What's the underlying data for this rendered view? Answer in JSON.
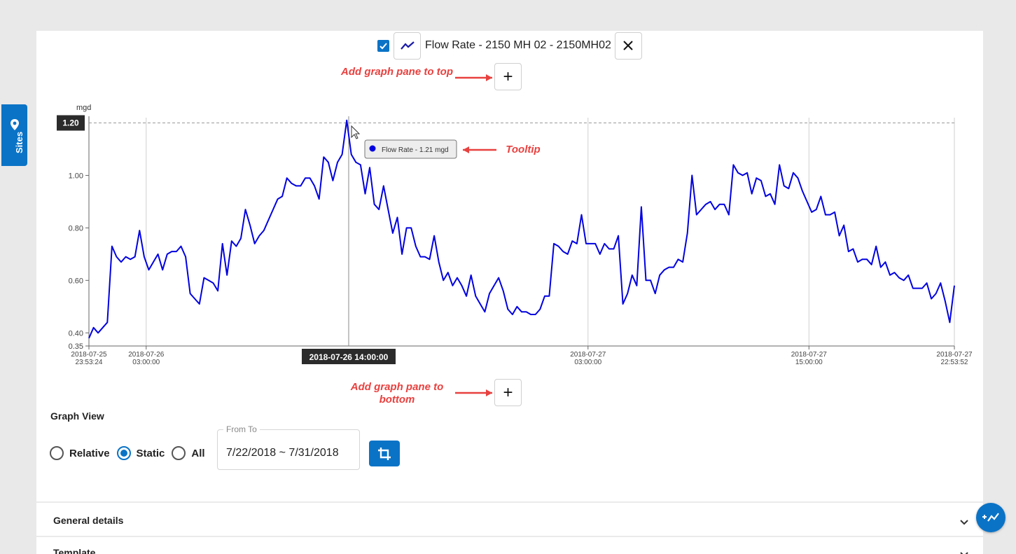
{
  "sidebar_tab": {
    "label": "Sites"
  },
  "legend": {
    "checked": true,
    "series_label": "Flow Rate - 2150 MH 02 - 2150MH02",
    "line_color": "#0000e0"
  },
  "annotations": {
    "add_top": "Add graph pane to top",
    "tooltip": "Tooltip",
    "add_bottom": "Add graph pane to bottom",
    "color": "#e8413f"
  },
  "add_button_label": "+",
  "chart_data": {
    "type": "line",
    "ylabel": "mgd",
    "ylim": [
      0.35,
      1.22
    ],
    "y_ticks": [
      "0.35",
      "0.40",
      "0.60",
      "0.80",
      "1.00"
    ],
    "y_tick_values": [
      0.35,
      0.4,
      0.6,
      0.8,
      1.0
    ],
    "reference_line": {
      "value": 1.2,
      "label": "1.20"
    },
    "x_ticks": [
      {
        "date": "2018-07-25",
        "time": "23:53:24",
        "hours": 0
      },
      {
        "date": "2018-07-26",
        "time": "03:00:00",
        "hours": 3.11
      },
      {
        "date": "2018-07-27",
        "time": "03:00:00",
        "hours": 27.11
      },
      {
        "date": "2018-07-27",
        "time": "15:00:00",
        "hours": 39.11
      },
      {
        "date": "2018-07-27",
        "time": "22:53:52",
        "hours": 47.01
      }
    ],
    "x_range_hours": [
      0,
      47.01
    ],
    "crosshair": {
      "label": "2018-07-26 14:00:00",
      "hours": 14.11
    },
    "tooltip": {
      "text": "Flow Rate - 1.21 mgd",
      "value": 1.21
    },
    "grid": "vertical",
    "series": [
      {
        "name": "Flow Rate",
        "color": "#0000e0",
        "values": [
          0.38,
          0.42,
          0.4,
          0.42,
          0.44,
          0.73,
          0.69,
          0.67,
          0.69,
          0.68,
          0.69,
          0.79,
          0.69,
          0.64,
          0.67,
          0.7,
          0.64,
          0.7,
          0.71,
          0.71,
          0.73,
          0.69,
          0.55,
          0.53,
          0.51,
          0.61,
          0.6,
          0.59,
          0.56,
          0.74,
          0.62,
          0.75,
          0.73,
          0.76,
          0.87,
          0.81,
          0.74,
          0.77,
          0.79,
          0.83,
          0.87,
          0.91,
          0.92,
          0.99,
          0.97,
          0.96,
          0.96,
          0.99,
          0.99,
          0.96,
          0.91,
          1.07,
          1.05,
          0.98,
          1.05,
          1.08,
          1.21,
          1.08,
          1.05,
          1.04,
          0.93,
          1.03,
          0.89,
          0.87,
          0.96,
          0.87,
          0.78,
          0.84,
          0.7,
          0.8,
          0.8,
          0.73,
          0.69,
          0.69,
          0.68,
          0.77,
          0.67,
          0.6,
          0.63,
          0.58,
          0.61,
          0.58,
          0.54,
          0.62,
          0.54,
          0.51,
          0.48,
          0.55,
          0.58,
          0.61,
          0.56,
          0.49,
          0.47,
          0.5,
          0.48,
          0.48,
          0.47,
          0.47,
          0.49,
          0.54,
          0.54,
          0.74,
          0.73,
          0.71,
          0.7,
          0.75,
          0.74,
          0.85,
          0.74,
          0.74,
          0.74,
          0.7,
          0.74,
          0.72,
          0.72,
          0.77,
          0.51,
          0.55,
          0.62,
          0.58,
          0.88,
          0.6,
          0.6,
          0.55,
          0.62,
          0.64,
          0.65,
          0.65,
          0.68,
          0.67,
          0.78,
          1.0,
          0.85,
          0.87,
          0.89,
          0.9,
          0.87,
          0.89,
          0.89,
          0.85,
          1.04,
          1.01,
          1.0,
          1.01,
          0.93,
          0.99,
          0.98,
          0.92,
          0.93,
          0.89,
          1.04,
          0.96,
          0.95,
          1.01,
          0.99,
          0.94,
          0.9,
          0.86,
          0.87,
          0.92,
          0.85,
          0.85,
          0.86,
          0.77,
          0.81,
          0.71,
          0.72,
          0.67,
          0.68,
          0.68,
          0.66,
          0.73,
          0.65,
          0.67,
          0.62,
          0.63,
          0.61,
          0.6,
          0.62,
          0.57,
          0.57,
          0.57,
          0.59,
          0.53,
          0.55,
          0.59,
          0.52,
          0.44,
          0.58
        ]
      }
    ]
  },
  "graph_view": {
    "title": "Graph View",
    "options": [
      {
        "label": "Relative",
        "selected": false
      },
      {
        "label": "Static",
        "selected": true
      },
      {
        "label": "All",
        "selected": false
      }
    ],
    "date_range_legend": "From To",
    "date_range_value": "7/22/2018 ~ 7/31/2018"
  },
  "sections": [
    {
      "title": "General details"
    },
    {
      "title": "Template"
    }
  ],
  "colors": {
    "accent": "#0a73c6",
    "annotation": "#e8413f"
  }
}
